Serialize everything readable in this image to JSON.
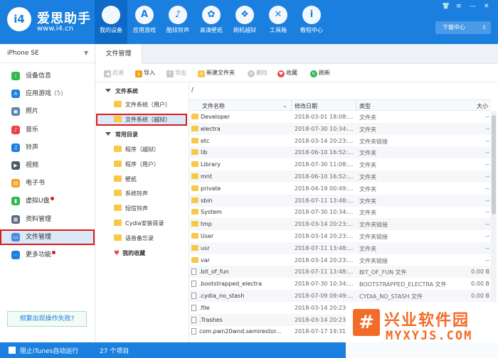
{
  "app": {
    "name": "爱思助手",
    "url": "www.i4.cn",
    "logo_text": "i4"
  },
  "nav": [
    {
      "label": "我的设备",
      "icon": "apple-icon",
      "glyph": "",
      "active": true
    },
    {
      "label": "应用游戏",
      "icon": "app-store-icon",
      "glyph": "A"
    },
    {
      "label": "酷炫铃声",
      "icon": "bell-icon",
      "glyph": "♪"
    },
    {
      "label": "高清壁纸",
      "icon": "flower-icon",
      "glyph": "✿"
    },
    {
      "label": "刷机越狱",
      "icon": "box-icon",
      "glyph": "❖"
    },
    {
      "label": "工具箱",
      "icon": "tools-icon",
      "glyph": "✕"
    },
    {
      "label": "教程中心",
      "icon": "info-icon",
      "glyph": "i"
    }
  ],
  "download_center": "下载中心",
  "device": {
    "name": "iPhone SE"
  },
  "sidebar": {
    "items": [
      {
        "label": "设备信息",
        "icon": "info-circle-icon",
        "color": "#2fb84b",
        "glyph": "i"
      },
      {
        "label": "应用游戏",
        "count": "(5)",
        "icon": "app-store-icon",
        "color": "#1a7fde",
        "glyph": "A"
      },
      {
        "label": "照片",
        "icon": "photo-icon",
        "color": "#5a7fa8",
        "glyph": "▣"
      },
      {
        "label": "音乐",
        "icon": "music-icon",
        "color": "#e8434d",
        "glyph": "♪"
      },
      {
        "label": "铃声",
        "icon": "bell-icon",
        "color": "#1a7fde",
        "glyph": "♫"
      },
      {
        "label": "视频",
        "icon": "video-icon",
        "color": "#4a5a6a",
        "glyph": "▶"
      },
      {
        "label": "电子书",
        "icon": "book-icon",
        "color": "#f0a020",
        "glyph": "▤"
      },
      {
        "label": "虚拟U盘",
        "icon": "usb-icon",
        "color": "#2fb84b",
        "glyph": "▮",
        "dot": true
      },
      {
        "label": "资料管理",
        "icon": "contacts-icon",
        "color": "#5a6a7a",
        "glyph": "▦"
      },
      {
        "label": "文件管理",
        "icon": "file-manager-icon",
        "color": "#4a8ae0",
        "glyph": "▭",
        "active": true
      },
      {
        "label": "更多功能",
        "icon": "more-icon",
        "color": "#1a7fde",
        "glyph": "⋯",
        "dot": true
      }
    ],
    "feedback": "频繁出现操作失败?"
  },
  "tab": {
    "label": "文件管理"
  },
  "toolbar": {
    "back": "后退",
    "import": "导入",
    "export": "导出",
    "new_folder": "新建文件夹",
    "delete": "删除",
    "favorite": "收藏",
    "refresh": "刷新"
  },
  "tree": {
    "filesystem": "文件系统",
    "filesystem_user": "文件系统（用户）",
    "filesystem_jailbreak": "文件系统（越狱）",
    "common": "常用目录",
    "common_items": [
      "程序（越狱）",
      "程序（用户）",
      "壁纸",
      "系统铃声",
      "短信铃声",
      "Cydia安装目录",
      "语音备忘录"
    ],
    "favorites": "我的收藏"
  },
  "path": "/",
  "columns": {
    "name": "文件名称",
    "date": "修改日期",
    "type": "类型",
    "size": "大小"
  },
  "files": [
    {
      "name": "Developer",
      "date": "2018-03-01 18:08:...",
      "type": "文件夹",
      "size": "--",
      "kind": "folder"
    },
    {
      "name": "electra",
      "date": "2018-07-30 10:34:...",
      "type": "文件夹",
      "size": "--",
      "kind": "folder"
    },
    {
      "name": "etc",
      "date": "2018-03-14 20:23:...",
      "type": "文件夹链接",
      "size": "--",
      "kind": "folder"
    },
    {
      "name": "lib",
      "date": "2018-06-10 16:52:...",
      "type": "文件夹",
      "size": "--",
      "kind": "folder"
    },
    {
      "name": "Library",
      "date": "2018-07-30 11:08:...",
      "type": "文件夹",
      "size": "--",
      "kind": "folder"
    },
    {
      "name": "mnt",
      "date": "2018-06-10 16:52:...",
      "type": "文件夹",
      "size": "--",
      "kind": "folder"
    },
    {
      "name": "private",
      "date": "2018-04-19 00:49:...",
      "type": "文件夹",
      "size": "--",
      "kind": "folder"
    },
    {
      "name": "sbin",
      "date": "2018-07-11 13:48:...",
      "type": "文件夹",
      "size": "--",
      "kind": "folder"
    },
    {
      "name": "System",
      "date": "2018-07-30 10:34:...",
      "type": "文件夹",
      "size": "--",
      "kind": "folder"
    },
    {
      "name": "tmp",
      "date": "2018-03-14 20:23:...",
      "type": "文件夹链接",
      "size": "--",
      "kind": "folder"
    },
    {
      "name": "User",
      "date": "2018-03-14 20:23:...",
      "type": "文件夹链接",
      "size": "--",
      "kind": "folder"
    },
    {
      "name": "usr",
      "date": "2018-07-11 13:48:...",
      "type": "文件夹",
      "size": "--",
      "kind": "folder"
    },
    {
      "name": "var",
      "date": "2018-03-14 20:23:...",
      "type": "文件夹链接",
      "size": "--",
      "kind": "folder"
    },
    {
      "name": ".bit_of_fun",
      "date": "2018-07-11 13:48:...",
      "type": "BIT_OF_FUN 文件",
      "size": "0.00 B",
      "kind": "file"
    },
    {
      "name": ".bootstrapped_electra",
      "date": "2018-07-30 10:34:...",
      "type": "BOOTSTRAPPED_ELECTRA 文件",
      "size": "0.00 B",
      "kind": "file"
    },
    {
      "name": ".cydia_no_stash",
      "date": "2018-07-09 09:49:...",
      "type": "CYDIA_NO_STASH 文件",
      "size": "0.00 B",
      "kind": "file"
    },
    {
      "name": ".file",
      "date": "2018-03-14 20:23:...",
      "type": "",
      "size": "",
      "kind": "file"
    },
    {
      "name": ".Trashes",
      "date": "2018-03-14 20:23:...",
      "type": "",
      "size": "",
      "kind": "file"
    },
    {
      "name": "com.pwn20wnd.semirestor...",
      "date": "2018-07-17 19:31:...",
      "type": "",
      "size": "",
      "kind": "file"
    }
  ],
  "status": {
    "itunes": "阻止iTunes自动运行",
    "item_count": "27 个项目"
  },
  "watermark": {
    "title": "兴业软件园",
    "url": "MYXYJS.COM"
  }
}
